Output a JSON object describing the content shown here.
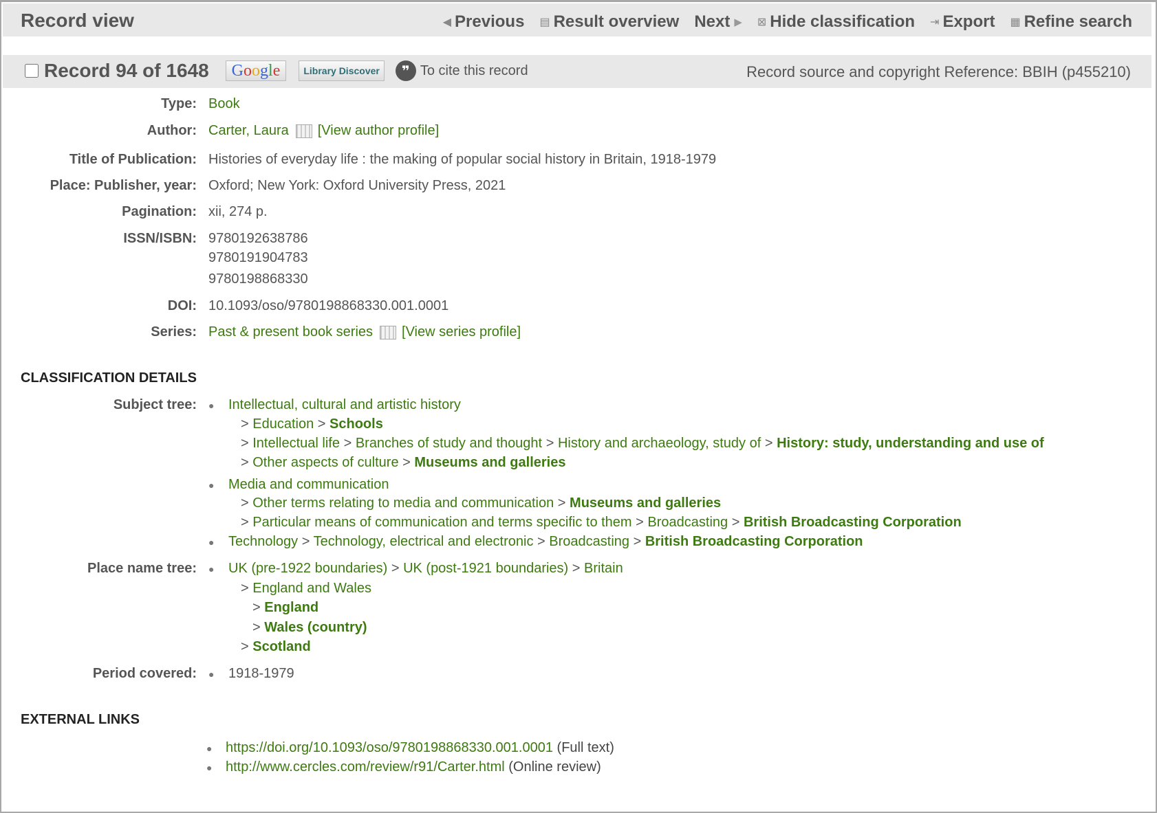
{
  "toolbar": {
    "title": "Record view",
    "previous": "Previous",
    "result_overview": "Result overview",
    "next": "Next",
    "hide_classification": "Hide classification",
    "export": "Export",
    "refine_search": "Refine search"
  },
  "record_bar": {
    "record_title": "Record 94 of 1648",
    "google_label": "Google",
    "library_discover_label": "Library Discover",
    "cite_label": "To cite this record",
    "source_label": "Record source and copyright Reference: BBIH (p455210)"
  },
  "fields": {
    "type_label": "Type:",
    "type_value": "Book",
    "author_label": "Author:",
    "author_value": "Carter, Laura",
    "author_profile": "[View author profile]",
    "title_label": "Title of Publication:",
    "title_value": "Histories of everyday life : the making of popular social history in Britain, 1918-1979",
    "publisher_label": "Place: Publisher, year:",
    "publisher_value": "Oxford; New York: Oxford University Press, 2021",
    "pagination_label": "Pagination:",
    "pagination_value": "xii, 274 p.",
    "isbn_label": "ISSN/ISBN:",
    "isbn_values": [
      "9780192638786",
      "9780191904783",
      "9780198868330"
    ],
    "doi_label": "DOI:",
    "doi_value": "10.1093/oso/9780198868330.001.0001",
    "series_label": "Series:",
    "series_value": "Past & present book series",
    "series_profile": "[View series profile]"
  },
  "classification": {
    "heading": "CLASSIFICATION DETAILS",
    "subject_label": "Subject tree:",
    "subject": {
      "s1_root": "Intellectual, cultural and artistic history",
      "s1a_1": "Education",
      "s1a_2": "Schools",
      "s1b_1": "Intellectual life",
      "s1b_2": "Branches of study and thought",
      "s1b_3": "History and archaeology, study of",
      "s1b_4": "History: study, understanding and use of",
      "s1c_1": "Other aspects of culture",
      "s1c_2": "Museums and galleries",
      "s2_root": "Media and communication",
      "s2a_1": "Other terms relating to media and communication",
      "s2a_2": "Museums and galleries",
      "s2b_1": "Particular means of communication and terms specific to them",
      "s2b_2": "Broadcasting",
      "s2b_3": "British Broadcasting Corporation",
      "s3_1": "Technology",
      "s3_2": "Technology, electrical and electronic",
      "s3_3": "Broadcasting",
      "s3_4": "British Broadcasting Corporation"
    },
    "place_label": "Place name tree:",
    "place": {
      "p1": "UK (pre-1922 boundaries)",
      "p2": "UK (post-1921 boundaries)",
      "p3": "Britain",
      "p4": "England and Wales",
      "p5": "England",
      "p6": "Wales (country)",
      "p7": "Scotland"
    },
    "period_label": "Period covered:",
    "period_value": "1918-1979",
    "separator": ">"
  },
  "external": {
    "heading": "EXTERNAL LINKS",
    "links": [
      {
        "url": "https://doi.org/10.1093/oso/9780198868330.001.0001",
        "note": "(Full text)"
      },
      {
        "url": "http://www.cercles.com/review/r91/Carter.html",
        "note": "(Online review)"
      }
    ]
  }
}
